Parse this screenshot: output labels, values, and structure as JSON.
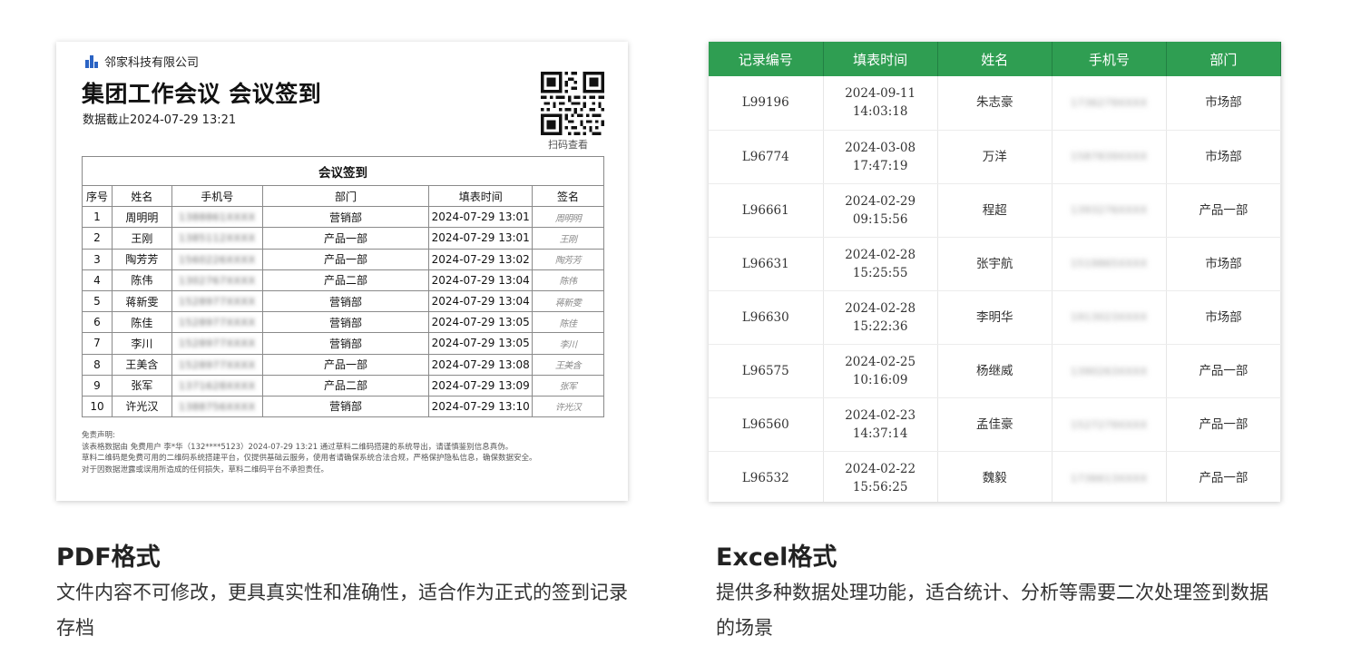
{
  "pdf": {
    "company": "邻家科技有限公司",
    "title": "集团工作会议 会议签到",
    "deadline": "数据截止2024-07-29 13:21",
    "qr_caption": "扫码查看",
    "table_title": "会议签到",
    "columns": [
      "序号",
      "姓名",
      "手机号",
      "部门",
      "填表时间",
      "签名"
    ],
    "rows": [
      {
        "no": "1",
        "name": "周明明",
        "phone": "1388861XXXX",
        "dept": "营销部",
        "time": "2024-07-29 13:01",
        "sig": "周明明"
      },
      {
        "no": "2",
        "name": "王刚",
        "phone": "1385112XXXX",
        "dept": "产品一部",
        "time": "2024-07-29 13:01",
        "sig": "王刚"
      },
      {
        "no": "3",
        "name": "陶芳芳",
        "phone": "1560226XXXX",
        "dept": "产品一部",
        "time": "2024-07-29 13:02",
        "sig": "陶芳芳"
      },
      {
        "no": "4",
        "name": "陈伟",
        "phone": "1302767XXXX",
        "dept": "产品二部",
        "time": "2024-07-29 13:04",
        "sig": "陈伟"
      },
      {
        "no": "5",
        "name": "蒋新雯",
        "phone": "1528977XXXX",
        "dept": "营销部",
        "time": "2024-07-29 13:04",
        "sig": "蒋新雯"
      },
      {
        "no": "6",
        "name": "陈佳",
        "phone": "1528977XXXX",
        "dept": "营销部",
        "time": "2024-07-29 13:05",
        "sig": "陈佳"
      },
      {
        "no": "7",
        "name": "李川",
        "phone": "1528977XXXX",
        "dept": "营销部",
        "time": "2024-07-29 13:05",
        "sig": "李川"
      },
      {
        "no": "8",
        "name": "王美含",
        "phone": "1528977XXXX",
        "dept": "产品一部",
        "time": "2024-07-29 13:08",
        "sig": "王美含"
      },
      {
        "no": "9",
        "name": "张军",
        "phone": "1371628XXXX",
        "dept": "产品二部",
        "time": "2024-07-29 13:09",
        "sig": "张军"
      },
      {
        "no": "10",
        "name": "许光汉",
        "phone": "1388756XXXX",
        "dept": "营销部",
        "time": "2024-07-29 13:10",
        "sig": "许光汉"
      }
    ],
    "disclaimer": [
      "免责声明:",
      "该表格数据由 免费用户 李*华（132****5123）2024-07-29 13:21 通过草料二维码搭建的系统导出，请谨慎鉴别信息真伪。",
      "草料二维码是免费可用的二维码系统搭建平台，仅提供基础云服务，使用者请确保系统合法合规，严格保护隐私信息，确保数据安全。",
      "对于因数据泄露或误用所造成的任何损失，草料二维码平台不承担责任。"
    ]
  },
  "excel": {
    "columns": [
      "记录编号",
      "填表时间",
      "姓名",
      "手机号",
      "部门"
    ],
    "rows": [
      {
        "id": "L99196",
        "date": "2024-09-11",
        "time": "14:03:18",
        "name": "朱志豪",
        "phone": "1736279XXXX",
        "dept": "市场部"
      },
      {
        "id": "L96774",
        "date": "2024-03-08",
        "time": "17:47:19",
        "name": "万洋",
        "phone": "1587839XXXX",
        "dept": "市场部"
      },
      {
        "id": "L96661",
        "date": "2024-02-29",
        "time": "09:15:56",
        "name": "程超",
        "phone": "1393276XXXX",
        "dept": "产品一部"
      },
      {
        "id": "L96631",
        "date": "2024-02-28",
        "time": "15:25:55",
        "name": "张宇航",
        "phone": "1519865XXXX",
        "dept": "市场部"
      },
      {
        "id": "L96630",
        "date": "2024-02-28",
        "time": "15:22:36",
        "name": "李明华",
        "phone": "1913023XXXX",
        "dept": "市场部"
      },
      {
        "id": "L96575",
        "date": "2024-02-25",
        "time": "10:16:09",
        "name": "杨继威",
        "phone": "1390263XXXX",
        "dept": "产品一部"
      },
      {
        "id": "L96560",
        "date": "2024-02-23",
        "time": "14:37:14",
        "name": "孟佳豪",
        "phone": "1527279XXXX",
        "dept": "产品一部"
      },
      {
        "id": "L96532",
        "date": "2024-02-22",
        "time": "15:56:25",
        "name": "魏毅",
        "phone": "1736613XXXX",
        "dept": "产品一部"
      }
    ]
  },
  "captions": {
    "pdf_title": "PDF格式",
    "pdf_desc": "文件内容不可修改，更具真实性和准确性，适合作为正式的签到记录存档",
    "excel_title": "Excel格式",
    "excel_desc": "提供多种数据处理功能，适合统计、分析等需要二次处理签到数据的场景"
  },
  "colors": {
    "excel_header": "#2f9e52",
    "logo_blue": "#2a63c4"
  },
  "icons": [
    "company-logo-icon",
    "qr-code-icon"
  ]
}
